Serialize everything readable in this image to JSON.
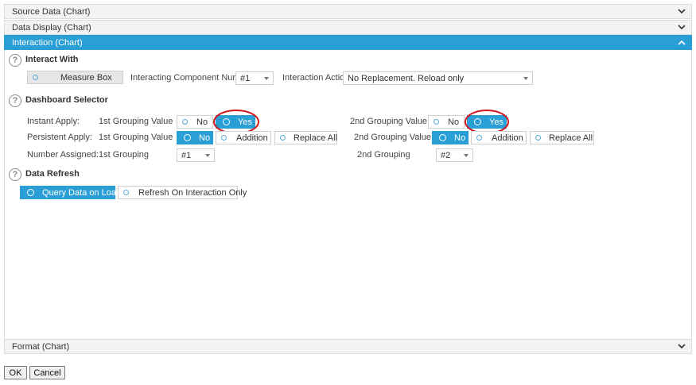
{
  "accordion": {
    "source_data": "Source Data (Chart)",
    "data_display": "Data Display (Chart)",
    "interaction": "Interaction (Chart)",
    "format": "Format (Chart)"
  },
  "icons": {
    "chevron_down": "chevron-down-icon",
    "chevron_up": "chevron-up-icon",
    "help": "help-icon"
  },
  "colors": {
    "accent": "#2a9fd6",
    "highlight": "#d3151a"
  },
  "interact_with": {
    "title": "Interact With",
    "measure_box": "Measure Box",
    "component_number_label": "Interacting Component Number:",
    "component_number_value": "#1",
    "action_label": "Interaction Action:",
    "action_value": "No Replacement. Reload only"
  },
  "dashboard_selector": {
    "title": "Dashboard Selector",
    "instant_apply": {
      "label": "Instant Apply:",
      "first_label": "1st Grouping Value",
      "first_no": "No",
      "first_yes": "Yes",
      "second_label": "2nd Grouping Value",
      "second_no": "No",
      "second_yes": "Yes"
    },
    "persistent_apply": {
      "label": "Persistent Apply:",
      "first_label": "1st Grouping Value",
      "first_no": "No",
      "first_addition": "Addition",
      "first_replace_all": "Replace All",
      "second_label": "2nd Grouping Value",
      "second_no": "No",
      "second_addition": "Addition",
      "second_replace_all": "Replace All"
    },
    "number_assigned": {
      "label": "Number Assigned:",
      "first_label": "1st Grouping",
      "first_value": "#1",
      "second_label": "2nd Grouping",
      "second_value": "#2"
    }
  },
  "data_refresh": {
    "title": "Data Refresh",
    "query_on_load": "Query Data on Load",
    "refresh_on_interaction": "Refresh On Interaction Only"
  },
  "footer": {
    "ok": "OK",
    "cancel": "Cancel"
  }
}
